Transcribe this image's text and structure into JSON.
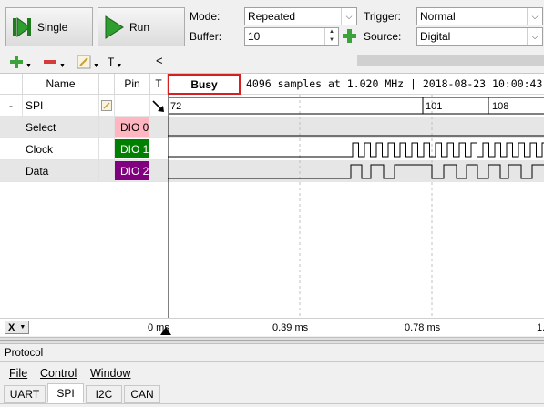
{
  "controls": {
    "single_label": "Single",
    "run_label": "Run",
    "mode_label": "Mode:",
    "mode_value": "Repeated",
    "buffer_label": "Buffer:",
    "buffer_value": "10",
    "trigger_label": "Trigger:",
    "trigger_value": "Normal",
    "source_label": "Source:",
    "source_value": "Digital"
  },
  "toolbar": {
    "text_tool": "T",
    "collapse": "<"
  },
  "columns": {
    "name": "Name",
    "pin": "Pin",
    "t": "T"
  },
  "status": {
    "busy": "Busy",
    "info": "4096 samples at 1.020 MHz | 2018-08-23 10:00:43"
  },
  "rows": [
    {
      "expander": "-",
      "name": "SPI",
      "pin": "",
      "pin_color": ""
    },
    {
      "expander": "",
      "name": "Select",
      "pin": "DIO 0",
      "pin_color": "#ffb6c1"
    },
    {
      "expander": "",
      "name": "Clock",
      "pin": "DIO 1",
      "pin_color": "#008000"
    },
    {
      "expander": "",
      "name": "Data",
      "pin": "DIO 2",
      "pin_color": "#800080"
    }
  ],
  "spi_values": [
    "72",
    "101",
    "108"
  ],
  "time_axis": {
    "t0": "0 ms",
    "t1": "0.39 ms",
    "t2": "0.78 ms",
    "t3": "1."
  },
  "x_button": "X",
  "protocol_label": "Protocol",
  "menu": {
    "file": "File",
    "control": "Control",
    "window": "Window"
  },
  "tabs": [
    "UART",
    "SPI",
    "I2C",
    "CAN"
  ],
  "active_tab": "SPI"
}
